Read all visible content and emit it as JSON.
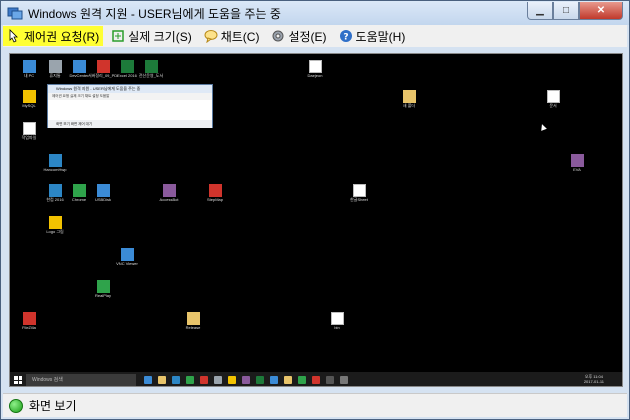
{
  "window": {
    "title": "Windows 원격 지원 - USER님에게 도움을 주는 중"
  },
  "toolbar": {
    "items": [
      {
        "label": "제어권 요청(R)",
        "icon": "hand-icon",
        "active": true
      },
      {
        "label": "실제 크기(S)",
        "icon": "actual-size-icon",
        "active": false
      },
      {
        "label": "채트(C)",
        "icon": "chat-icon",
        "active": false
      },
      {
        "label": "설정(E)",
        "icon": "settings-icon",
        "active": false
      },
      {
        "label": "도움말(H)",
        "icon": "help-icon",
        "active": false
      }
    ]
  },
  "status": {
    "label": "화면 보기",
    "icon": "connected-status-icon",
    "color": "#1a9d17"
  },
  "remote": {
    "inner_window_title": "Windows 원격 지원 - USER님에게 도움을 주는 중",
    "inner_toolbar": "제어권 요청   실제 크기   채트   설정   도움말",
    "inner_status": "화면 보기   화면 제어 대기",
    "taskbar_search": "Windows 검색",
    "clock_time": "오후 11:04",
    "clock_date": "2017-01-11",
    "icons": [
      {
        "label": "내 PC",
        "kind": "img"
      },
      {
        "label": "휴지통",
        "kind": "rec"
      },
      {
        "label": "DevCenter",
        "kind": "img"
      },
      {
        "label": "서버정리_09_PDF",
        "kind": "red"
      },
      {
        "label": "Excel 2016",
        "kind": "xl"
      },
      {
        "label": "전산운영_도서",
        "kind": "xl"
      },
      {
        "label": "Daejeon",
        "kind": "doc"
      },
      {
        "label": "새 폴더",
        "kind": "fold"
      },
      {
        "label": "문서",
        "kind": "doc"
      },
      {
        "label": "MySQL",
        "kind": "yel"
      },
      {
        "label": "HancomHwp",
        "kind": "hwp"
      },
      {
        "label": "작업파일",
        "kind": "doc"
      },
      {
        "label": "Chrome",
        "kind": "grn"
      },
      {
        "label": "한컴 2016",
        "kind": "hwp"
      },
      {
        "label": "USBDisk",
        "kind": "img"
      },
      {
        "label": "EVA",
        "kind": "pur"
      },
      {
        "label": "AccessBot",
        "kind": "pur"
      },
      {
        "label": "StepMap",
        "kind": "red"
      },
      {
        "label": "한글Sheet",
        "kind": "doc"
      },
      {
        "label": "Logo 그림",
        "kind": "yel"
      },
      {
        "label": "RealPlay",
        "kind": "grn"
      },
      {
        "label": "VNC Viewer",
        "kind": "img"
      },
      {
        "label": "FileZilla",
        "kind": "red"
      },
      {
        "label": "Release",
        "kind": "fold"
      },
      {
        "label": "bin",
        "kind": "doc"
      }
    ]
  }
}
